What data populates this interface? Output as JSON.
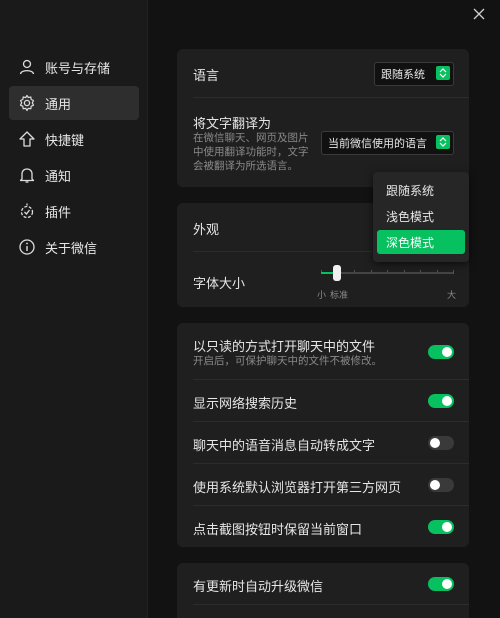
{
  "sidebar": {
    "items": [
      {
        "label": "账号与存储",
        "icon": "user-icon",
        "active": false
      },
      {
        "label": "通用",
        "icon": "gear-icon",
        "active": true
      },
      {
        "label": "快捷键",
        "icon": "shortcut-icon",
        "active": false
      },
      {
        "label": "通知",
        "icon": "bell-icon",
        "active": false
      },
      {
        "label": "插件",
        "icon": "plugin-icon",
        "active": false
      },
      {
        "label": "关于微信",
        "icon": "info-icon",
        "active": false
      }
    ]
  },
  "language": {
    "label": "语言",
    "value": "跟随系统"
  },
  "translate": {
    "label": "将文字翻译为",
    "desc_line1": "在微信聊天、网页及图片",
    "desc_line2": "中使用翻译功能时，文字",
    "desc_line3": "会被翻译为所选语言。",
    "value": "当前微信使用的语言"
  },
  "appearance": {
    "label": "外观",
    "options": [
      "跟随系统",
      "浅色模式",
      "深色模式"
    ],
    "selected": "深色模式"
  },
  "font_size": {
    "label": "字体大小",
    "min_label": "小",
    "default_label": "标准",
    "max_label": "大",
    "level": 0.12
  },
  "toggles": [
    {
      "label": "以只读的方式打开聊天中的文件",
      "desc": "开启后，可保护聊天中的文件不被修改。",
      "on": true
    },
    {
      "label": "显示网络搜索历史",
      "on": true
    },
    {
      "label": "聊天中的语音消息自动转成文字",
      "on": false
    },
    {
      "label": "使用系统默认浏览器打开第三方网页",
      "on": false
    },
    {
      "label": "点击截图按钮时保留当前窗口",
      "on": true
    }
  ],
  "update": {
    "label": "有更新时自动升级微信",
    "on": true
  },
  "colors": {
    "accent": "#07c160",
    "card": "#1f1f1f",
    "background": "#121212"
  }
}
